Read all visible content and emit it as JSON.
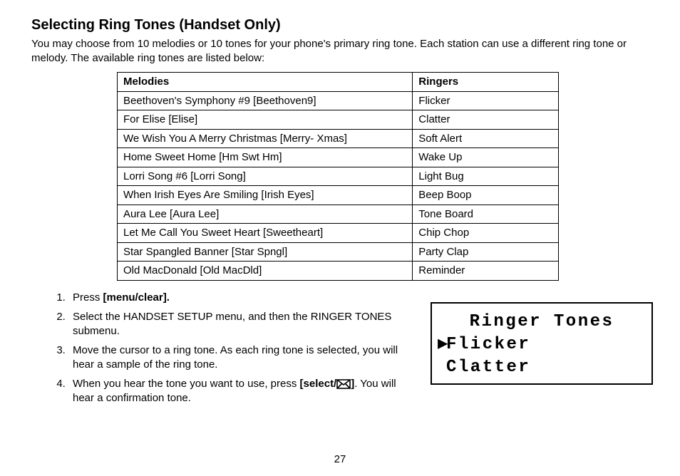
{
  "title": "Selecting Ring Tones (Handset Only)",
  "intro": "You may choose from 10 melodies or 10 tones for your phone's primary ring tone. Each station can use a different ring tone or melody.  The available ring tones are listed below:",
  "headers": {
    "melodies": "Melodies",
    "ringers": "Ringers"
  },
  "rows": [
    {
      "m": "Beethoven's Symphony #9 [Beethoven9]",
      "r": "Flicker"
    },
    {
      "m": "For Elise [Elise]",
      "r": "Clatter"
    },
    {
      "m": "We Wish You A Merry Christmas [Merry- Xmas]",
      "r": "Soft Alert"
    },
    {
      "m": "Home Sweet Home [Hm Swt Hm]",
      "r": "Wake Up"
    },
    {
      "m": "Lorri Song #6 [Lorri Song]",
      "r": "Light Bug"
    },
    {
      "m": "When Irish Eyes Are Smiling [Irish Eyes]",
      "r": "Beep Boop"
    },
    {
      "m": "Aura Lee [Aura Lee]",
      "r": "Tone Board"
    },
    {
      "m": "Let Me Call You Sweet Heart [Sweetheart]",
      "r": "Chip Chop"
    },
    {
      "m": "Star Spangled Banner [Star Spngl]",
      "r": "Party Clap"
    },
    {
      "m": "Old MacDonald [Old MacDld]",
      "r": "Reminder"
    }
  ],
  "steps": {
    "s1a": "Press ",
    "s1b": "[menu/clear].",
    "s2": "Select the HANDSET SETUP menu, and then the RINGER TONES submenu.",
    "s3": "Move the cursor to a ring tone. As each ring tone is selected, you will hear a sample of the ring tone.",
    "s4a": "When you hear the tone you want to use, press ",
    "s4b": "[select/",
    "s4c": "]",
    "s4d": ". You will hear a confirmation tone."
  },
  "lcd": {
    "title": "Ringer Tones",
    "line1": "Flicker",
    "line2": "Clatter"
  },
  "page_number": "27"
}
